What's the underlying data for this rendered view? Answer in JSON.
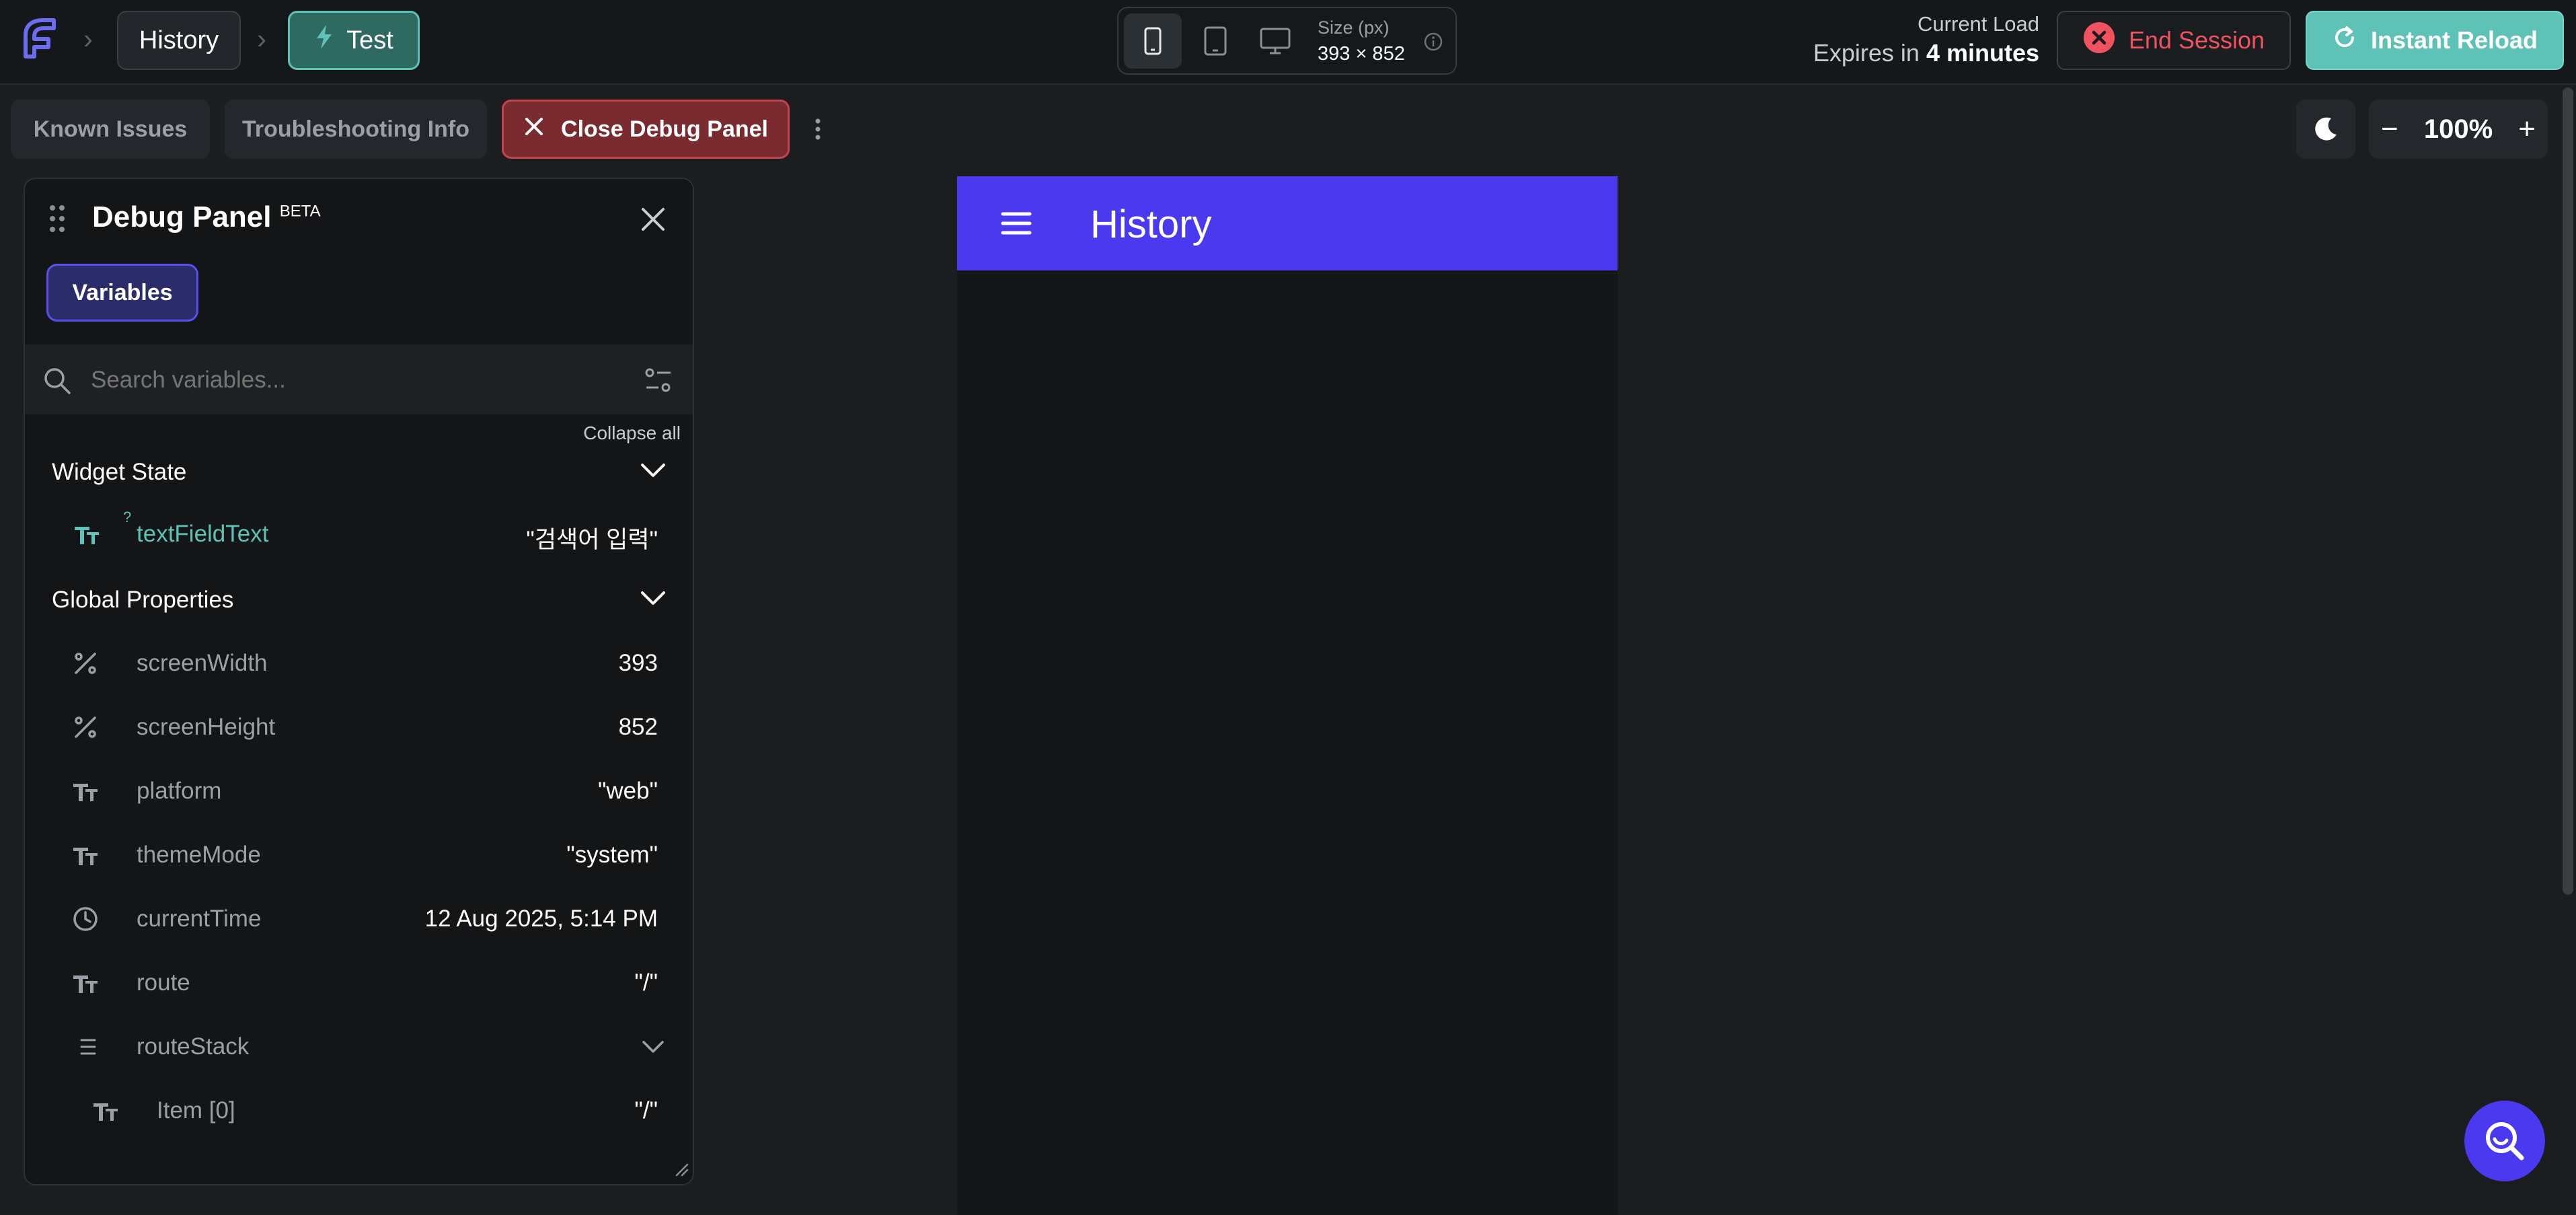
{
  "topbar": {
    "breadcrumb_page": "History",
    "breadcrumb_mode": "Test",
    "size_label": "Size (px)",
    "size_value": "393 × 852",
    "current_load_label": "Current Load",
    "expires_prefix": "Expires in ",
    "expires_value": "4 minutes",
    "end_session": "End Session",
    "instant_reload": "Instant Reload",
    "accent_color": "#5ec3b6",
    "danger_color": "#f0525f"
  },
  "toolbar": {
    "known_issues": "Known Issues",
    "troubleshooting": "Troubleshooting Info",
    "close_debug": "Close Debug Panel",
    "zoom": "100%"
  },
  "panel": {
    "title": "Debug Panel",
    "badge": "BETA",
    "tab_variables": "Variables",
    "search_placeholder": "Search variables...",
    "collapse_all": "Collapse all",
    "widget_state_title": "Widget State",
    "widget_state": [
      {
        "icon": "text-type-icon",
        "name": "textFieldText",
        "value": "\"검색어 입력\""
      }
    ],
    "global_title": "Global Properties",
    "globals": [
      {
        "icon": "number-icon",
        "name": "screenWidth",
        "value": "393"
      },
      {
        "icon": "number-icon",
        "name": "screenHeight",
        "value": "852"
      },
      {
        "icon": "text-type-icon",
        "name": "platform",
        "value": "\"web\""
      },
      {
        "icon": "text-type-icon",
        "name": "themeMode",
        "value": "\"system\""
      },
      {
        "icon": "clock-icon",
        "name": "currentTime",
        "value": "12 Aug 2025, 5:14 PM"
      },
      {
        "icon": "text-type-icon",
        "name": "route",
        "value": "\"/\""
      },
      {
        "icon": "list-icon",
        "name": "routeStack",
        "value": ""
      },
      {
        "icon": "text-type-icon",
        "name": "Item [0]",
        "value": "\"/\""
      }
    ]
  },
  "preview": {
    "app_title": "History",
    "appbar_color": "#4b39ef"
  }
}
